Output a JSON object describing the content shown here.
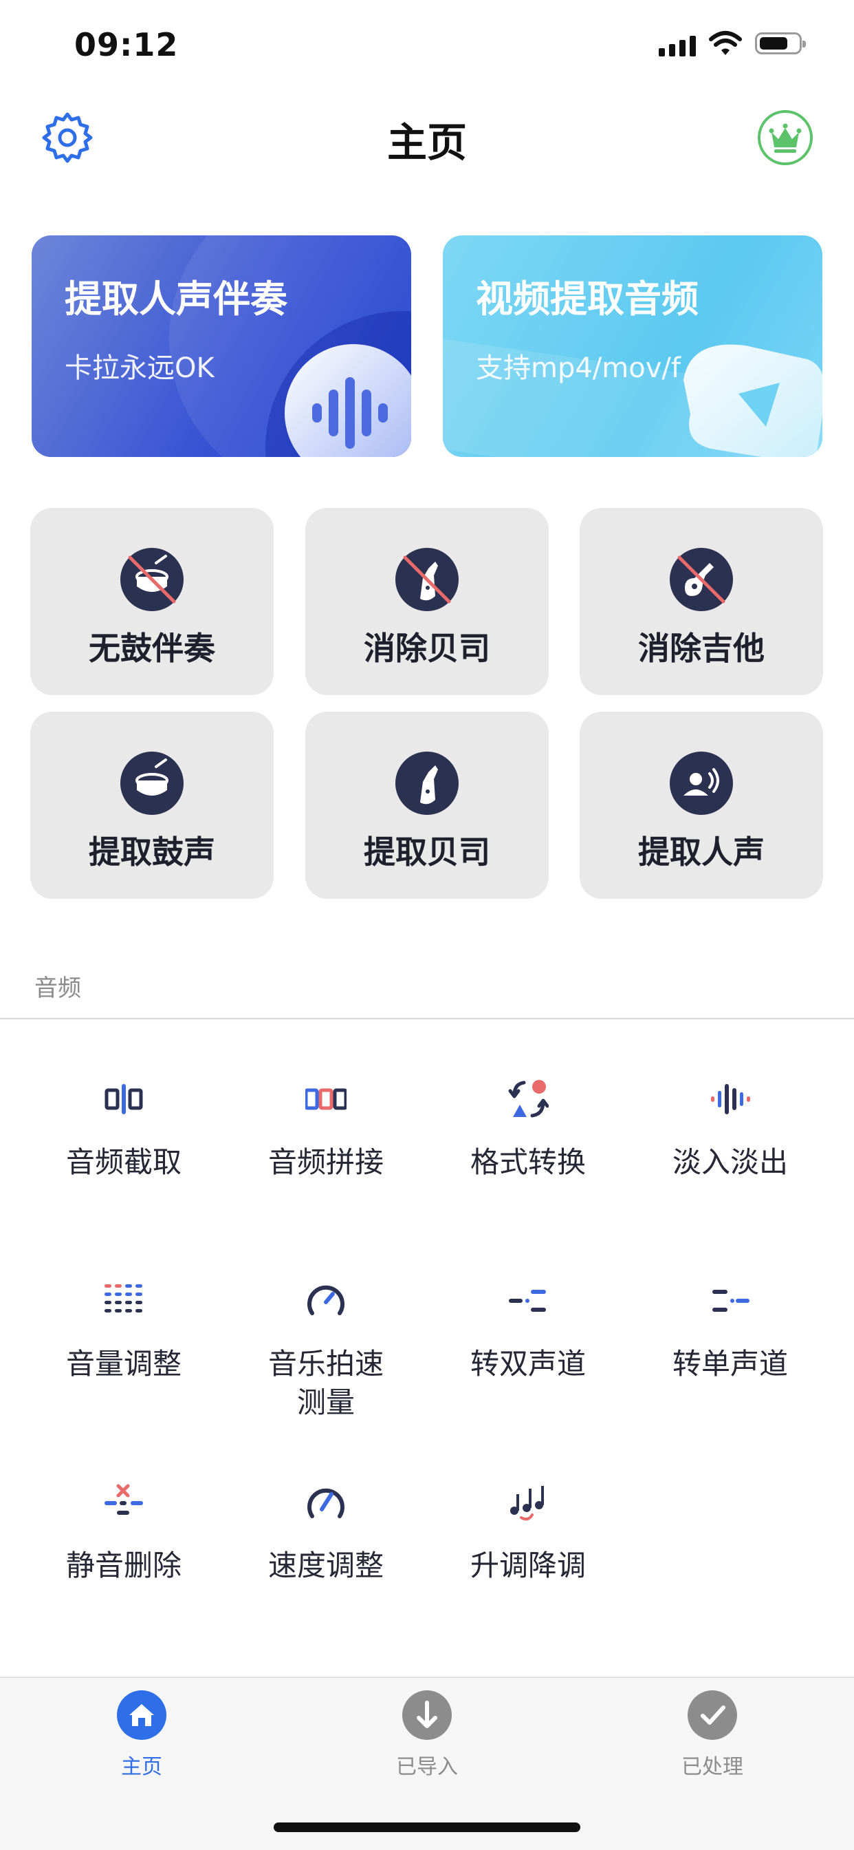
{
  "status_bar": {
    "time": "09:12"
  },
  "header": {
    "title": "主页",
    "settings_icon": "gear-icon",
    "vip_icon": "crown-icon",
    "vip_color": "#5cc36b",
    "accent": "#2e6ee8"
  },
  "banners": [
    {
      "title": "提取人声伴奏",
      "subtitle": "卡拉永远OK",
      "icon": "waveform-icon"
    },
    {
      "title": "视频提取音频",
      "subtitle": "支持mp4/mov/f",
      "icon": "play-icon"
    }
  ],
  "tiles": [
    {
      "label": "无鼓伴奏",
      "icon": "no-drum-icon"
    },
    {
      "label": "消除贝司",
      "icon": "no-bass-icon"
    },
    {
      "label": "消除吉他",
      "icon": "no-guitar-icon"
    },
    {
      "label": "提取鼓声",
      "icon": "drum-icon"
    },
    {
      "label": "提取贝司",
      "icon": "bass-icon"
    },
    {
      "label": "提取人声",
      "icon": "voice-icon"
    }
  ],
  "section": {
    "title": "音频"
  },
  "tools": [
    {
      "label": "音频截取",
      "icon": "audio-cut-icon"
    },
    {
      "label": "音频拼接",
      "icon": "audio-join-icon"
    },
    {
      "label": "格式转换",
      "icon": "format-convert-icon"
    },
    {
      "label": "淡入淡出",
      "icon": "fade-icon"
    },
    {
      "label": "音量调整",
      "icon": "volume-icon"
    },
    {
      "label": "音乐拍速\n测量",
      "icon": "tempo-icon"
    },
    {
      "label": "转双声道",
      "icon": "stereo-icon"
    },
    {
      "label": "转单声道",
      "icon": "mono-icon"
    },
    {
      "label": "静音删除",
      "icon": "silence-remove-icon"
    },
    {
      "label": "速度调整",
      "icon": "speed-icon"
    },
    {
      "label": "升调降调",
      "icon": "pitch-icon"
    }
  ],
  "tabs": [
    {
      "label": "主页",
      "icon": "home-icon",
      "active": true
    },
    {
      "label": "已导入",
      "icon": "download-icon",
      "active": false
    },
    {
      "label": "已处理",
      "icon": "check-icon",
      "active": false
    }
  ]
}
